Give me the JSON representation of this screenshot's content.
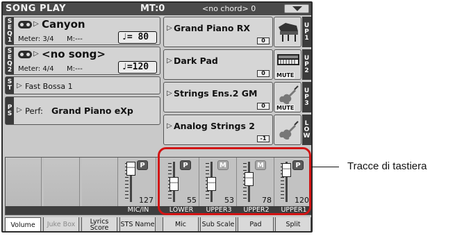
{
  "title_bar": {
    "mode": "SONG PLAY",
    "mt": "MT:0",
    "chord": "<no chord> 0",
    "menu_icon": "triangle-down-icon"
  },
  "sequencers": [
    {
      "tag": [
        "S",
        "E",
        "Q",
        "1"
      ],
      "song": "Canyon",
      "meter": "Meter: 3/4",
      "measure": "M:---",
      "tempo_symbol": "♩",
      "tempo": "= 80"
    },
    {
      "tag": [
        "S",
        "E",
        "Q",
        "2"
      ],
      "song": "<no song>",
      "meter": "Meter: 4/4",
      "measure": "M:---",
      "tempo_symbol": "♩",
      "tempo": "=120"
    }
  ],
  "style": {
    "tag": [
      "S",
      "T"
    ],
    "name": "Fast Bossa 1"
  },
  "performance": {
    "tag": [
      "P",
      "S"
    ],
    "label": "Perf:",
    "name": "Grand Piano eXp"
  },
  "keyboard_tracks": [
    {
      "name": "Grand Piano RX",
      "octave": "0",
      "icon": "grand-piano-icon",
      "tag": [
        "U",
        "P",
        "1"
      ],
      "mute": ""
    },
    {
      "name": "Dark Pad",
      "octave": "0",
      "icon": "synth-keyboard-icon",
      "tag": [
        "U",
        "P",
        "2"
      ],
      "mute": "MUTE"
    },
    {
      "name": "Strings Ens.2 GM",
      "octave": "0",
      "icon": "violin-icon",
      "tag": [
        "U",
        "P",
        "3"
      ],
      "mute": "MUTE"
    },
    {
      "name": "Analog Strings 2",
      "octave": "-1",
      "icon": "violin-icon",
      "tag": [
        "L",
        "O",
        "W"
      ],
      "mute": ""
    }
  ],
  "mixer": {
    "channels": [
      {
        "label": "",
        "value": ""
      },
      {
        "label": "",
        "value": ""
      },
      {
        "label": "",
        "value": ""
      },
      {
        "label": "MIC/IN",
        "value": "127",
        "status": "P",
        "level": 127
      },
      {
        "label": "LOWER",
        "value": "55",
        "status": "P",
        "level": 55
      },
      {
        "label": "UPPER3",
        "value": "53",
        "status": "M",
        "level": 53
      },
      {
        "label": "UPPER2",
        "value": "78",
        "status": "M",
        "level": 78
      },
      {
        "label": "UPPER1",
        "value": "120",
        "status": "P",
        "level": 120
      }
    ]
  },
  "tabs": [
    {
      "label": "Volume",
      "active": true
    },
    {
      "label": "Juke Box",
      "dim": true
    },
    {
      "label": "Lyrics Score"
    },
    {
      "label": "STS Name"
    },
    {
      "label": "Mic"
    },
    {
      "label": "Sub Scale"
    },
    {
      "label": "Pad"
    },
    {
      "label": "Split"
    }
  ],
  "callout": {
    "text": "Tracce di tastiera"
  },
  "colors": {
    "highlight": "#d21414",
    "display_bg": "#c9c9c9",
    "header_bg": "#4a4a4a"
  }
}
